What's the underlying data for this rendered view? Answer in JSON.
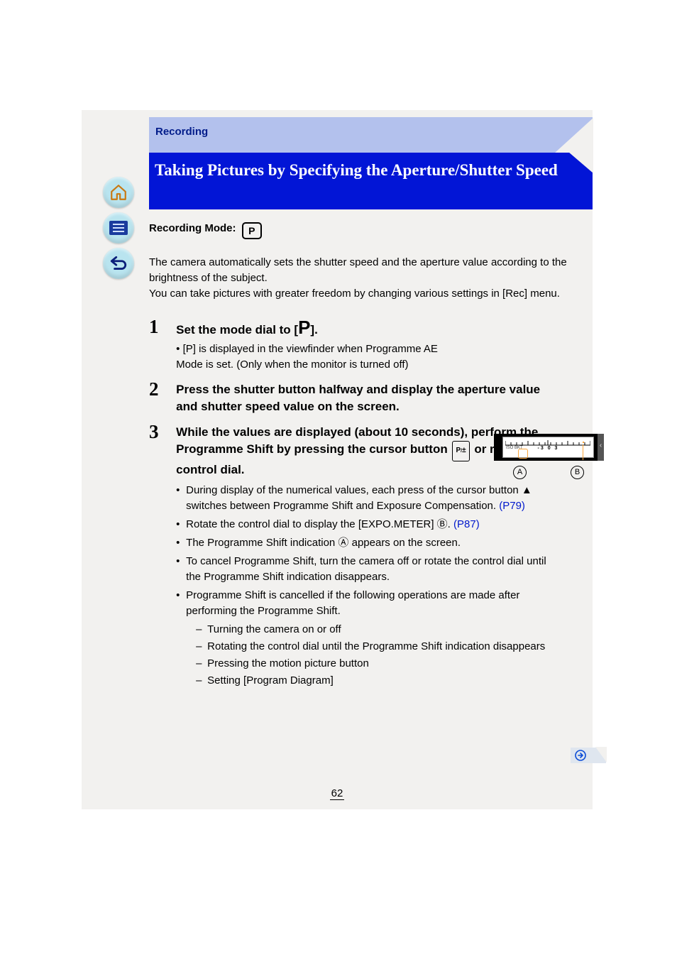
{
  "strip_label": "Recording",
  "title": "Taking Pictures by Specifying the Aperture/Shutter Speed",
  "recording_mode_label": "Recording Mode:",
  "mode_icon_letter": "P",
  "intro": "The camera automatically sets the shutter speed and the aperture value according to the brightness of the subject.\nYou can take pictures with greater freedom by changing various settings in [Rec] menu.",
  "step1": {
    "num": "1",
    "head_prefix": "Set the mode dial to [",
    "head_letter": "P",
    "head_suffix": "].",
    "sub": "• [P] is displayed in the viewfinder when Programme AE Mode is set. (Only when the monitor is turned off)"
  },
  "step2": {
    "num": "2",
    "head": "Press the shutter button halfway and display the aperture value and shutter speed value on the screen."
  },
  "step3": {
    "num": "3",
    "head_a": "While the values are displayed (about 10 seconds), perform the Programme Shift by pressing the cursor button ",
    "head_b": " or rotating the control dial.",
    "bullets": [
      {
        "lead": "During display of the numerical values, each press of the cursor button ▲ switches between Programme Shift and Exposure Compensation.",
        "cross": "(P79)"
      },
      {
        "lead": "Rotate the control dial to display the [EXPO.METER] Ⓑ.",
        "cross": "(P87)"
      },
      {
        "text": "The Programme Shift indication Ⓐ appears on the screen."
      },
      {
        "text": "To cancel Programme Shift, turn the camera off or rotate the control dial until the Programme Shift indication disappears."
      },
      {
        "lead": "Programme Shift is cancelled if the following operations are made after performing the Programme Shift.",
        "dashes": [
          "Turning the camera on or off",
          "Rotating the control dial until the Programme Shift indication disappears",
          "Pressing the motion picture button",
          "Setting [Program Diagram]"
        ]
      }
    ]
  },
  "figure": {
    "labels": "-3  0  3",
    "iso_text": "ISO BKT",
    "tab_glyph": "‹",
    "a_letter": "A",
    "b_letter": "B"
  },
  "page_number": "62"
}
